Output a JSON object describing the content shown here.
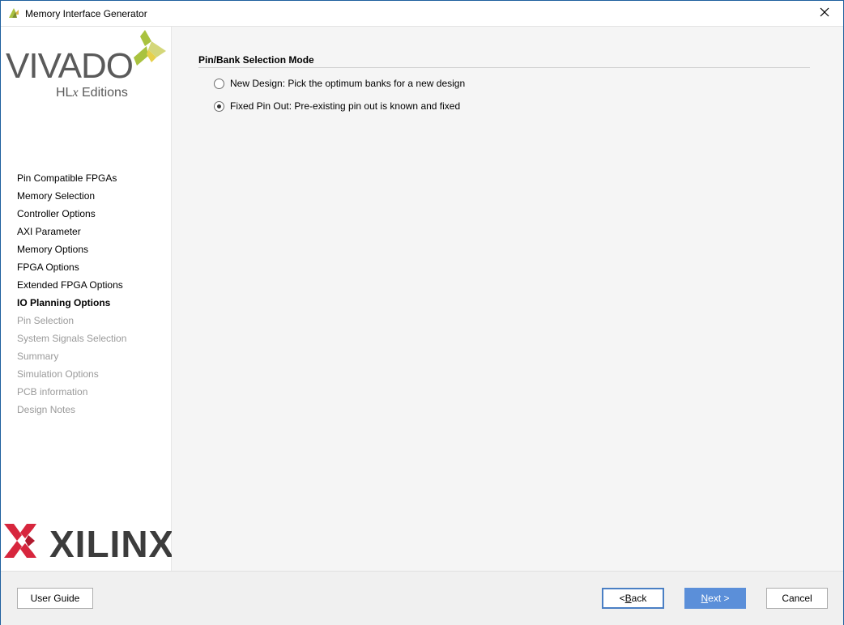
{
  "window": {
    "title": "Memory Interface Generator"
  },
  "branding": {
    "product_logo_text": "VIVADO",
    "edition_prefix": "HL",
    "edition_x": "x",
    "edition_suffix": " Editions",
    "vendor_logo_text": "XILINX",
    "vendor_mark": "®",
    "colors": {
      "vivado_green": "#a9c23f",
      "xilinx_red": "#d7263d"
    }
  },
  "steps": [
    {
      "label": "Pin Compatible FPGAs",
      "state": "done"
    },
    {
      "label": "Memory Selection",
      "state": "done"
    },
    {
      "label": "Controller Options",
      "state": "done"
    },
    {
      "label": "AXI Parameter",
      "state": "done"
    },
    {
      "label": "Memory Options",
      "state": "done"
    },
    {
      "label": "FPGA Options",
      "state": "done"
    },
    {
      "label": "Extended FPGA Options",
      "state": "done"
    },
    {
      "label": "IO Planning Options",
      "state": "current"
    },
    {
      "label": "Pin Selection",
      "state": "disabled"
    },
    {
      "label": "System Signals Selection",
      "state": "disabled"
    },
    {
      "label": "Summary",
      "state": "disabled"
    },
    {
      "label": "Simulation Options",
      "state": "disabled"
    },
    {
      "label": "PCB information",
      "state": "disabled"
    },
    {
      "label": "Design Notes",
      "state": "disabled"
    }
  ],
  "main": {
    "section_title": "Pin/Bank Selection Mode",
    "options": [
      {
        "label": "New Design: Pick the optimum banks for a new design",
        "checked": false
      },
      {
        "label": "Fixed Pin Out: Pre-existing pin out is known and fixed",
        "checked": true
      }
    ]
  },
  "footer": {
    "user_guide_label": "User Guide",
    "back_label_pre": "< ",
    "back_label_key": "B",
    "back_label_post": "ack",
    "next_label_key": "N",
    "next_label_post": "ext >",
    "cancel_label": "Cancel"
  }
}
